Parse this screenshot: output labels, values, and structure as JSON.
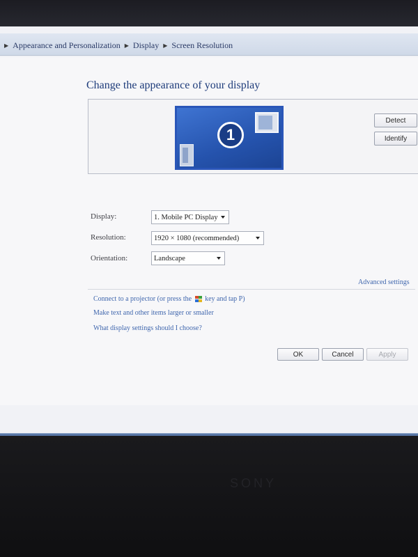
{
  "breadcrumb": {
    "items": [
      "Appearance and Personalization",
      "Display",
      "Screen Resolution"
    ]
  },
  "page": {
    "title": "Change the appearance of your display"
  },
  "preview": {
    "monitor_number": "1",
    "detect_label": "Detect",
    "identify_label": "Identify"
  },
  "settings": {
    "display_label": "Display:",
    "display_value": "1. Mobile PC Display",
    "resolution_label": "Resolution:",
    "resolution_value": "1920 × 1080 (recommended)",
    "orientation_label": "Orientation:",
    "orientation_value": "Landscape",
    "advanced_link": "Advanced settings"
  },
  "links": {
    "projector_pre": "Connect to a projector (or press the",
    "projector_post": "key and tap P)",
    "text_size": "Make text and other items larger or smaller",
    "help": "What display settings should I choose?"
  },
  "buttons": {
    "ok": "OK",
    "cancel": "Cancel",
    "apply": "Apply"
  },
  "taskbar": {
    "icons": [
      "start-icon",
      "chrome-icon",
      "utorrent-icon",
      "network-icon",
      "screen-resolution-icon"
    ]
  },
  "colors": {
    "title": "#1d3b7a",
    "link": "#3f66ad",
    "monitor_fill": "#2553ad",
    "taskbar": "#3c5d8f"
  }
}
